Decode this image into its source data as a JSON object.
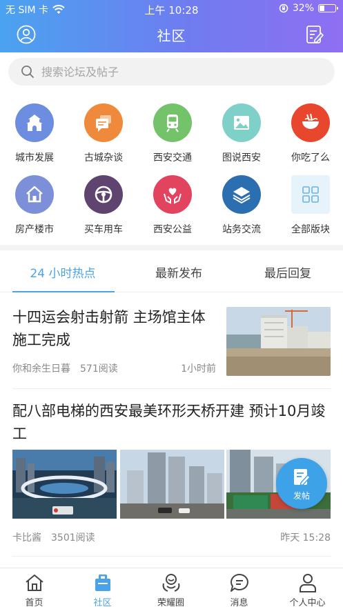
{
  "status_bar": {
    "carrier": "无 SIM 卡",
    "time": "上午 10:28",
    "battery": "32%",
    "battery_level": 0.32
  },
  "nav": {
    "title": "社区",
    "left_icon": "user-avatar-icon",
    "right_icon": "edit-note-icon"
  },
  "search": {
    "placeholder": "搜索论坛及帖子"
  },
  "categories": [
    {
      "label": "城市发展",
      "icon": "city-gate-icon",
      "color": "#6d8de0"
    },
    {
      "label": "古城杂谈",
      "icon": "chat-bubbles-icon",
      "color": "#ef8a3c"
    },
    {
      "label": "西安交通",
      "icon": "train-icon",
      "color": "#74c36a"
    },
    {
      "label": "图说西安",
      "icon": "picture-icon",
      "color": "#7ed0c9"
    },
    {
      "label": "你吃了么",
      "icon": "noodle-bowl-icon",
      "color": "#e8472e"
    },
    {
      "label": "房产楼市",
      "icon": "house-icon",
      "color": "#7c8fd8"
    },
    {
      "label": "买车用车",
      "icon": "steering-wheel-icon",
      "color": "#5f4470"
    },
    {
      "label": "西安公益",
      "icon": "heart-hands-icon",
      "color": "#e2435f"
    },
    {
      "label": "站务交流",
      "icon": "layers-icon",
      "color": "#2c6fb0"
    },
    {
      "label": "全部版块",
      "icon": "grid-icon",
      "color": "#e6f3fb"
    }
  ],
  "tabs": [
    {
      "label": "24 小时热点",
      "active": true
    },
    {
      "label": "最新发布",
      "active": false
    },
    {
      "label": "最后回复",
      "active": false
    }
  ],
  "posts": [
    {
      "title": "十四运会射击射箭 主场馆主体施工完成",
      "author": "你和余生日暮",
      "reads": "571阅读",
      "time": "1小时前"
    },
    {
      "title": "配八部电梯的西安最美环形天桥开建 预计10月竣工",
      "author": "卡比酱",
      "reads": "3501阅读",
      "time": "昨天 15:28"
    }
  ],
  "fab": {
    "label": "发帖"
  },
  "tabbar": [
    {
      "label": "首页",
      "icon": "home-icon",
      "active": false
    },
    {
      "label": "社区",
      "icon": "community-icon",
      "active": true
    },
    {
      "label": "荣耀圈",
      "icon": "honor-circle-icon",
      "active": false
    },
    {
      "label": "消息",
      "icon": "message-icon",
      "active": false
    },
    {
      "label": "个人中心",
      "icon": "profile-icon",
      "active": false
    }
  ],
  "colors": {
    "accent": "#4aa3e8",
    "header_gradient_start": "#4aa3f0",
    "header_gradient_end": "#8f6ff2"
  }
}
